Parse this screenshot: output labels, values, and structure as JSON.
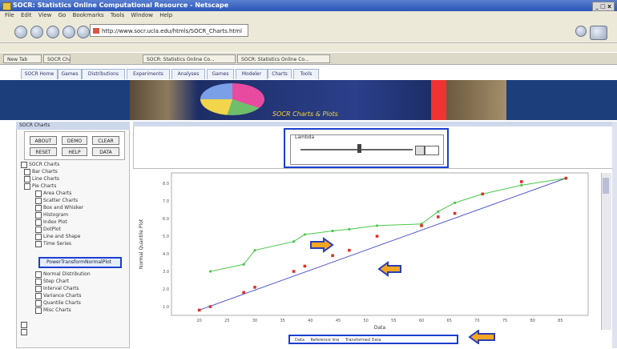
{
  "window": {
    "title": "SOCR: Statistics Online Computational Resource - Netscape",
    "controls": "_ □ x"
  },
  "menu": [
    "File",
    "Edit",
    "View",
    "Go",
    "Bookmarks",
    "Tools",
    "Window",
    "Help"
  ],
  "address": {
    "url": "http://www.socr.ucla.edu/htmls/SOCR_Charts.html"
  },
  "browser_tabs": [
    {
      "label": "New Tab"
    },
    {
      "label": "SOCR Charts"
    },
    {
      "label": "SOCR: Statistics Online Co..."
    },
    {
      "label": "SOCR: Statistics Online Co..."
    }
  ],
  "app_tabs": [
    {
      "label": "SOCR Home"
    },
    {
      "label": "Games"
    },
    {
      "label": "Distributions"
    },
    {
      "label": "Experiments"
    },
    {
      "label": "Analyses"
    },
    {
      "label": "Games"
    },
    {
      "label": "Modeler"
    },
    {
      "label": "Charts"
    },
    {
      "label": "Tools"
    }
  ],
  "banner": {
    "caption": "SOCR Charts & Plots"
  },
  "left_panel": {
    "header": "SOCR Charts",
    "buttons": [
      "ABOUT",
      "DEMO",
      "CLEAR",
      "RESET",
      "HELP",
      "DATA"
    ],
    "tree": [
      "SOCR Charts",
      "Bar Charts",
      "Line Charts",
      "Pie Charts",
      "Area Charts",
      "Scatter Charts",
      "Box and Whisker",
      "Histogram",
      "Index Plot",
      "DotPlot",
      "Line and Shape",
      "Time Series",
      "Normal Distribution",
      "Step Chart",
      "Interval Charts",
      "Variance Charts",
      "Quantile Charts",
      "Misc Charts"
    ],
    "selected_item": "PowerTransformNormalPlot"
  },
  "controls": {
    "label": "Lambda"
  },
  "chart_data": {
    "type": "scatter",
    "xlabel": "Data",
    "ylabel": "Normal Quantile Plot",
    "legend": [
      "Data",
      "Reference line",
      "Transformed Data"
    ],
    "series": [
      {
        "name": "Data",
        "x": [
          20,
          22,
          28,
          30,
          37,
          39,
          44,
          47,
          52,
          60,
          63,
          66,
          71,
          78,
          86
        ],
        "y": [
          0.8,
          1.0,
          1.8,
          2.1,
          3.0,
          3.3,
          3.9,
          4.2,
          5.0,
          5.6,
          6.1,
          6.3,
          7.4,
          8.1,
          8.3
        ]
      },
      {
        "name": "Reference line",
        "x": [
          20,
          86
        ],
        "y": [
          0.8,
          8.3
        ]
      },
      {
        "name": "Transformed Data",
        "x": [
          22,
          28,
          30,
          37,
          39,
          44,
          47,
          52,
          60,
          63,
          66,
          71,
          78,
          86
        ],
        "y": [
          3.0,
          3.4,
          4.2,
          4.7,
          5.1,
          5.3,
          5.4,
          5.6,
          5.7,
          6.4,
          6.9,
          7.4,
          7.9,
          8.3
        ]
      }
    ],
    "xlim": [
      15,
      90
    ],
    "ylim": [
      0.5,
      8.6
    ],
    "grid": false,
    "legend_position": "bottom"
  },
  "colors": {
    "highlight": "#1a3fcf",
    "arrow": "#f5a623",
    "series_data": "#e0302a",
    "series_reference": "#4d55c8",
    "series_transformed": "#49c84a"
  },
  "icons": [
    "back-icon",
    "forward-icon",
    "reload-icon",
    "stop-icon",
    "home-icon"
  ]
}
